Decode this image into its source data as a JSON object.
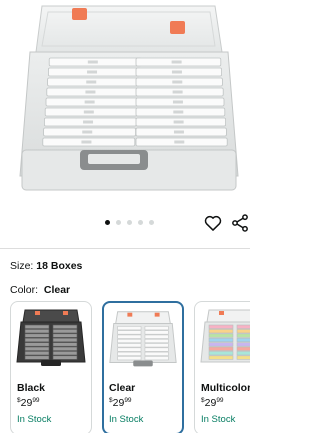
{
  "product": {
    "image_alt": "Clear 18-box photo storage case",
    "image_count": 5,
    "active_image_index": 0
  },
  "actions": {
    "wishlist_icon": "heart-icon",
    "share_icon": "share-icon"
  },
  "size": {
    "label": "Size:",
    "value": "18 Boxes"
  },
  "color": {
    "label": "Color:",
    "value": "Clear"
  },
  "variants": [
    {
      "name": "Black",
      "price_symbol": "$",
      "price_whole": "29",
      "price_fraction": "99",
      "stock": "In Stock",
      "selected": false,
      "case_color": "#3a3a3a"
    },
    {
      "name": "Clear",
      "price_symbol": "$",
      "price_whole": "29",
      "price_fraction": "99",
      "stock": "In Stock",
      "selected": true,
      "case_color": "#e8eaea"
    },
    {
      "name": "Multicolor",
      "price_symbol": "$",
      "price_whole": "29",
      "price_fraction": "99",
      "stock": "In Stock",
      "selected": false,
      "case_color": "#cfe9c8"
    }
  ],
  "colors": {
    "accent": "#2f6f9f",
    "stock_green": "#067d62",
    "latch_orange": "#f07b55"
  }
}
